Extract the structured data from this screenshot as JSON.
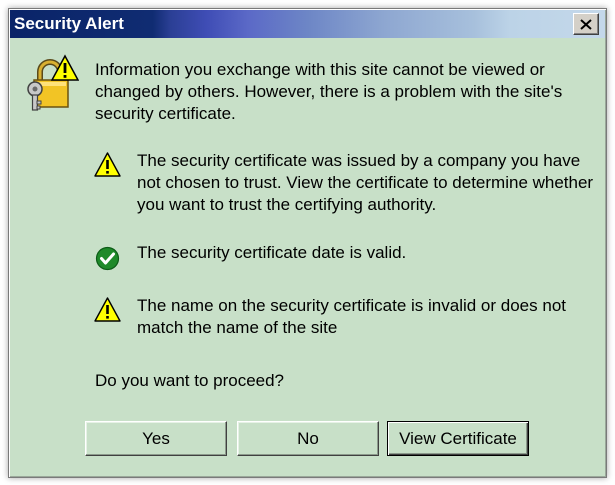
{
  "window": {
    "title": "Security Alert",
    "close_icon": "close-icon"
  },
  "dialog_icon": "lock-warning-icon",
  "intro": {
    "lines": [
      "Information you exchange with this site cannot be viewed or",
      "changed by others. However, there is a problem with the site's",
      "security certificate."
    ]
  },
  "items": [
    {
      "icon": "warning-icon",
      "lines": [
        "The security certificate was issued by a company you have",
        "not chosen to trust. View the certificate to determine whether",
        "you want to trust the certifying authority."
      ]
    },
    {
      "icon": "check-icon",
      "lines": [
        "The security certificate date is valid."
      ]
    },
    {
      "icon": "warning-icon",
      "lines": [
        "The name on the security certificate is invalid or does not",
        "match the name of the site"
      ]
    }
  ],
  "question": "Do you want to proceed?",
  "buttons": {
    "yes": "Yes",
    "no": "No",
    "view_certificate": "View Certificate"
  },
  "colors": {
    "title_bar_start": "#0a2468",
    "title_bar_end": "#c4d8ea",
    "dialog_background": "#c8e0c8",
    "warning": "#ffff00",
    "check": "#1f8a2a"
  }
}
